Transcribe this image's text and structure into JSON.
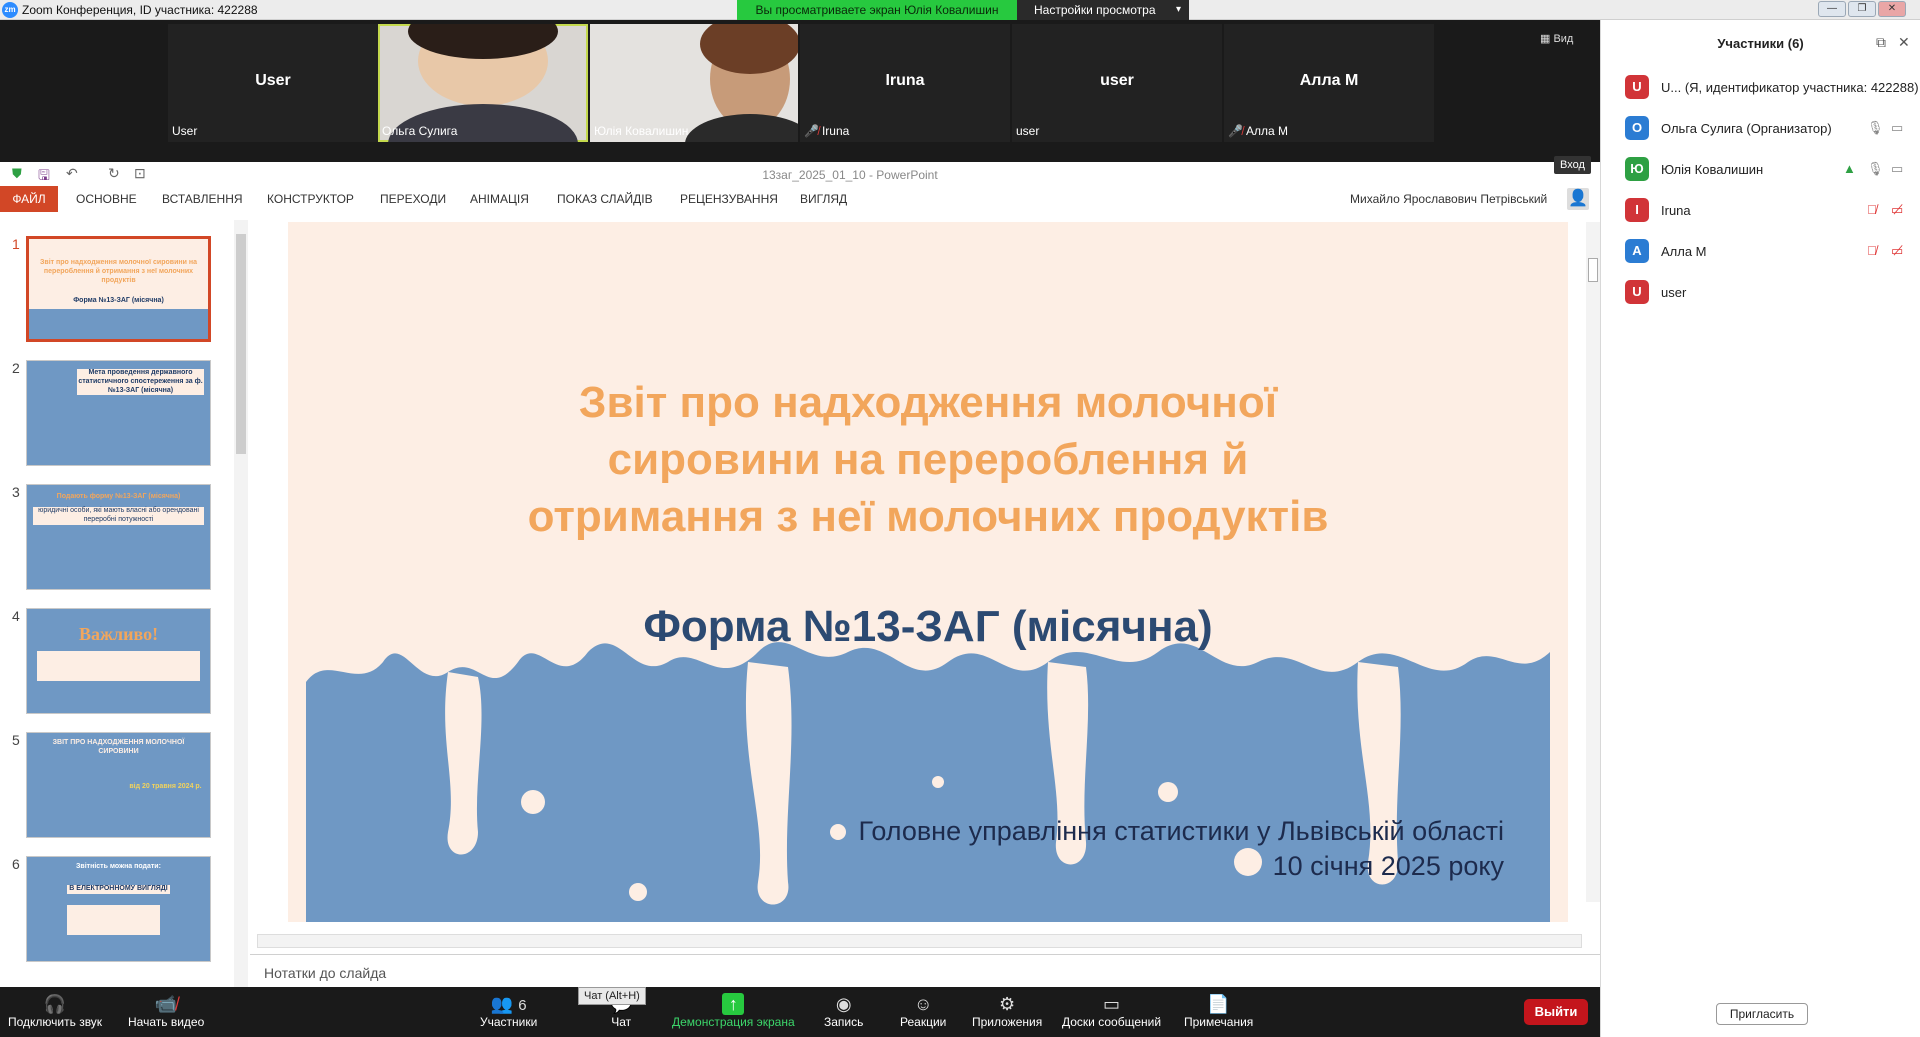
{
  "zoom": {
    "window_title": "Zoom Конференция, ID участника: 422288",
    "share_banner": "Вы просматриваете экран Юлія Ковалишин",
    "view_settings": "Настройки просмотра",
    "view_button": "Вид",
    "tiles": [
      {
        "name": "User",
        "label": "User",
        "muted": false
      },
      {
        "name": "",
        "label": "Ольга Сулига",
        "muted": false
      },
      {
        "name": "",
        "label": "Юлія Ковалишин",
        "muted": false
      },
      {
        "name": "Iruna",
        "label": "Iruna",
        "muted": true
      },
      {
        "name": "user",
        "label": "user",
        "muted": false
      },
      {
        "name": "Алла М",
        "label": "Алла М",
        "muted": true
      }
    ],
    "panel": {
      "title": "Участники (6)",
      "participants": [
        {
          "initial": "U",
          "name": "U... (Я, идентификатор участника: 422288)",
          "color": "#d13438"
        },
        {
          "initial": "О",
          "name": "Ольга Сулига (Организатор)",
          "color": "#2b7cd3"
        },
        {
          "initial": "Ю",
          "name": "Юлія Ковалишин",
          "color": "#2ea043"
        },
        {
          "initial": "I",
          "name": "Iruna",
          "color": "#d13438"
        },
        {
          "initial": "А",
          "name": "Алла М",
          "color": "#2b7cd3"
        },
        {
          "initial": "U",
          "name": "user",
          "color": "#d13438"
        }
      ],
      "invite": "Пригласить"
    },
    "toolbar": {
      "audio": "Подключить звук",
      "video": "Начать видео",
      "participants": "Участники",
      "participants_count": "6",
      "chat": "Чат",
      "chat_tooltip": "Чат (Alt+H)",
      "share": "Демонстрация экрана",
      "record": "Запись",
      "reactions": "Реакции",
      "apps": "Приложения",
      "whiteboards": "Доски сообщений",
      "notes": "Примечания",
      "leave": "Выйти"
    }
  },
  "ppt": {
    "title": "13заг_2025_01_10 - PowerPoint",
    "login_tip": "Вход",
    "tabs": {
      "file": "ФАЙЛ",
      "home": "ОСНОВНЕ",
      "insert": "ВСТАВЛЕННЯ",
      "design": "КОНСТРУКТОР",
      "transitions": "ПЕРЕХОДИ",
      "animations": "АНІМАЦІЯ",
      "slideshow": "ПОКАЗ СЛАЙДІВ",
      "review": "РЕЦЕНЗУВАННЯ",
      "view": "ВИГЛЯД"
    },
    "user": "Михайло Ярославович Петрівський",
    "notes": "Нотатки до слайда",
    "slide": {
      "title_lines": [
        "Звіт про надходження молочної",
        "сировини на перероблення й",
        "отримання з неї молочних продуктів"
      ],
      "form": "Форма №13-ЗАГ (місячна)",
      "org": "Головне управління статистики у Львівській області",
      "date": "10 січня 2025 року"
    },
    "thumbnails": [
      {
        "num": "1",
        "text": "Звіт про надходження молочної сировини на перероблення й отримання з неї молочних продуктів",
        "sub": "Форма №13-ЗАГ (місячна)"
      },
      {
        "num": "2",
        "text": "Мета проведення державного статистичного спостереження за ф.№13-ЗАГ (місячна)",
        "sub": ""
      },
      {
        "num": "3",
        "text": "Подають форму №13-ЗАГ (місячна)",
        "sub": "юридичні особи, які мають власні або орендовані переробні потужності"
      },
      {
        "num": "4",
        "text": "Важливо!",
        "sub": ""
      },
      {
        "num": "5",
        "text": "ЗВІТ ПРО НАДХОДЖЕННЯ МОЛОЧНОЇ СИРОВИНИ",
        "sub": "від 20 травня 2024 р."
      },
      {
        "num": "6",
        "text": "Звітність можна подати:",
        "sub": "В ЕЛЕКТРОННОМУ ВИГЛЯДІ"
      }
    ]
  }
}
